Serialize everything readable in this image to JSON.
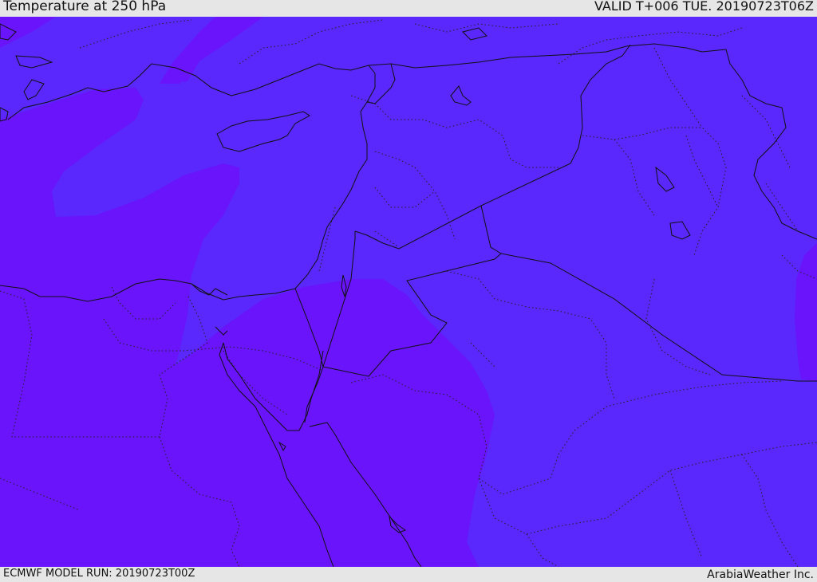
{
  "header": {
    "title": "Temperature at 250 hPa",
    "valid": "VALID T+006 TUE. 20190723T06Z"
  },
  "footer": {
    "model_run": "ECMWF MODEL RUN: 20190723T00Z",
    "credit": "ArabiaWeather Inc."
  },
  "colors": {
    "warm_field": "#6a14fb",
    "cool_field": "#5a28fc",
    "coastline": "#111111",
    "frame": "#e6e6e6"
  }
}
